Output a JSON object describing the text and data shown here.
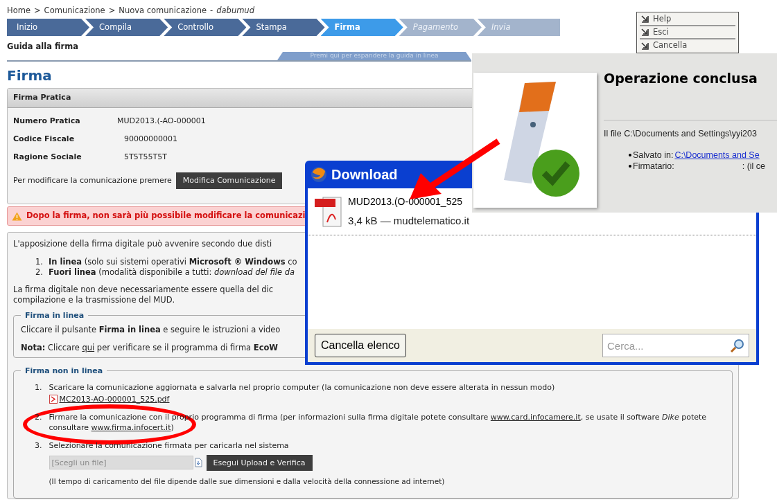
{
  "breadcrumb": {
    "items": [
      "Home",
      "Comunicazione",
      "Nuova comunicazione"
    ],
    "separator": ">",
    "user_separator": "-",
    "user": "dabumud"
  },
  "steps": [
    {
      "label": "Inizio",
      "selected": false,
      "disabled": false
    },
    {
      "label": "Compila",
      "selected": false,
      "disabled": false
    },
    {
      "label": "Controllo",
      "selected": false,
      "disabled": false
    },
    {
      "label": "Stampa",
      "selected": false,
      "disabled": false
    },
    {
      "label": "Firma",
      "selected": true,
      "disabled": false
    },
    {
      "label": "Pagamento",
      "selected": false,
      "disabled": true
    },
    {
      "label": "Invia",
      "selected": false,
      "disabled": true
    }
  ],
  "side_menu": [
    "Help",
    "Esci",
    "Cancella"
  ],
  "guide": {
    "title": "Guida alla firma",
    "expand_label": "Premi qui per espandere la guida in linea"
  },
  "heading": "Firma",
  "practice_panel": {
    "title": "Firma Pratica",
    "fields": [
      {
        "label": "Numero Pratica",
        "value": "MUD2013.(-AO-000001"
      },
      {
        "label": "Codice Fiscale",
        "value": "90000000001"
      },
      {
        "label": "Ragione Sociale",
        "value": "5T5T55T5T"
      }
    ],
    "modify_text": "Per modificare la comunicazione premere",
    "modify_button": "Modifica Comunicazione"
  },
  "warning": "Dopo la firma, non sarà più possibile modificare la comunicazi",
  "info": {
    "intro": "L'apposizione della firma digitale può avvenire secondo due disti",
    "modes": [
      {
        "number": "1.",
        "text": "**In linea** (solo sui sistemi operativi **Microsoft ® Windows** co"
      },
      {
        "number": "2.",
        "text": "**Fuori linea** (modalità disponibile a tutti: *download del file da*"
      }
    ],
    "note_lines": [
      "La firma digitale non deve necessariamente essere quella del dic",
      "compilazione e la trasmissione del MUD."
    ]
  },
  "online_section": {
    "title": "Firma in linea",
    "instruction": "Cliccare il pulsante **Firma in linea** e seguire le istruzioni a video",
    "note_before": "**Nota:** Cliccare ",
    "note_link": "qui",
    "note_after": " per verificare se il programma di firma **EcoW**"
  },
  "offline_section": {
    "title": "Firma non in linea",
    "steps": [
      {
        "number": "1.",
        "parts": [
          {
            "kind": "text",
            "text": "Scaricare la comunicazione aggiornata e salvarla nel proprio computer (la comunicazione non deve essere alterata in nessun modo)"
          }
        ],
        "file": "MC2013-AO-000001_525.pdf"
      },
      {
        "number": "2.",
        "parts": [
          {
            "kind": "text",
            "text": "Firmare la comunicazione con il proprio programma di firma (per informazioni sulla firma digitale potete consultare "
          },
          {
            "kind": "link",
            "text": "www.card.infocamere.it"
          },
          {
            "kind": "text",
            "text": ", se usate il software *Dike* potete consultare "
          },
          {
            "kind": "link",
            "text": "www.firma.infocert.it"
          },
          {
            "kind": "text",
            "text": ")"
          }
        ]
      },
      {
        "number": "3.",
        "parts": [
          {
            "kind": "text",
            "text": "Selezionare la comunicazione firmata per caricarla nel sistema"
          }
        ],
        "upload": {
          "placeholder": "[Scegli un file]",
          "button": "Esegui Upload e Verifica",
          "hint": "(Il tempo di caricamento del file dipende dalle sue dimensioni e dalla velocità della connessione ad internet)"
        }
      }
    ]
  },
  "operation_window": {
    "title": "Operazione conclusa",
    "message": "Il file C:\\Documents and Settings\\yyi203",
    "details": [
      {
        "label": "Salvato in:",
        "value": "C:\\Documents and Se",
        "kind": "link"
      },
      {
        "label": "Firmatario:",
        "value": ": (il ce",
        "kind": "text"
      }
    ]
  },
  "download_window": {
    "title": "Download",
    "items": [
      {
        "name": "MUD2013.(O-000001_525",
        "meta": "3,4 kB — mudtelematico.it"
      }
    ],
    "clear_button": "Cancella elenco",
    "search_placeholder": "Cerca..."
  }
}
